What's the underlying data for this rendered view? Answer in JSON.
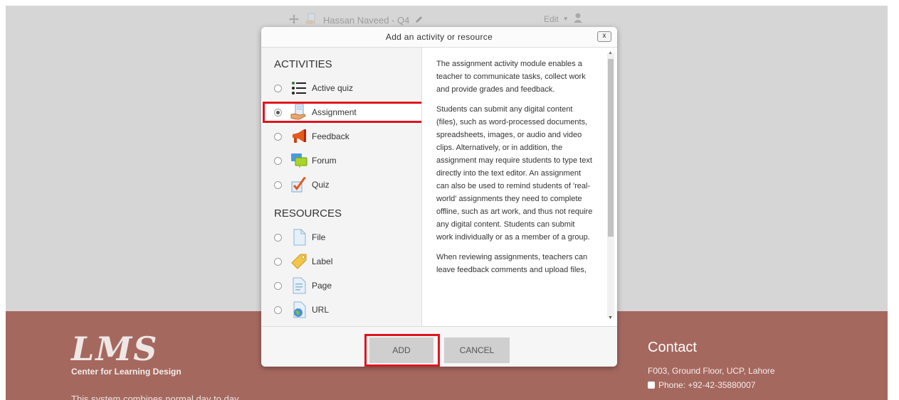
{
  "background": {
    "course_item": "Hassan Naveed - Q4",
    "edit_label": "Edit"
  },
  "modal": {
    "title": "Add an activity or resource",
    "close_label": "x",
    "activities_title": "ACTIVITIES",
    "activities": [
      {
        "label": "Active quiz",
        "icon": "list-icon",
        "selected": false
      },
      {
        "label": "Assignment",
        "icon": "assignment-icon",
        "selected": true
      },
      {
        "label": "Feedback",
        "icon": "megaphone-icon",
        "selected": false
      },
      {
        "label": "Forum",
        "icon": "forum-icon",
        "selected": false
      },
      {
        "label": "Quiz",
        "icon": "checkmark-icon",
        "selected": false
      }
    ],
    "resources_title": "RESOURCES",
    "resources": [
      {
        "label": "File",
        "icon": "file-icon"
      },
      {
        "label": "Label",
        "icon": "tag-icon"
      },
      {
        "label": "Page",
        "icon": "page-icon"
      },
      {
        "label": "URL",
        "icon": "globe-icon"
      }
    ],
    "description": [
      "The assignment activity module enables a teacher to communicate tasks, collect work and provide grades and feedback.",
      "Students can submit any digital content (files), such as word-processed documents, spreadsheets, images, or audio and video clips. Alternatively, or in addition, the assignment may require students to type text directly into the text editor. An assignment can also be used to remind students of 'real-world' assignments they need to complete offline, such as art work, and thus not require any digital content. Students can submit work individually or as a member of a group.",
      "When reviewing assignments, teachers can leave feedback comments and upload files,"
    ],
    "add_label": "ADD",
    "cancel_label": "CANCEL"
  },
  "footer": {
    "logo_text": "LMS",
    "logo_subtitle": "Center for Learning Design",
    "description": "This system combines normal day to day",
    "contact_title": "Contact",
    "address": "F003, Ground Floor, UCP, Lahore",
    "phone": "Phone: +92-42-35880007"
  },
  "colors": {
    "footer": "#a5685f",
    "highlight": "#e0141e",
    "backdrop": "#d6d6d6"
  }
}
